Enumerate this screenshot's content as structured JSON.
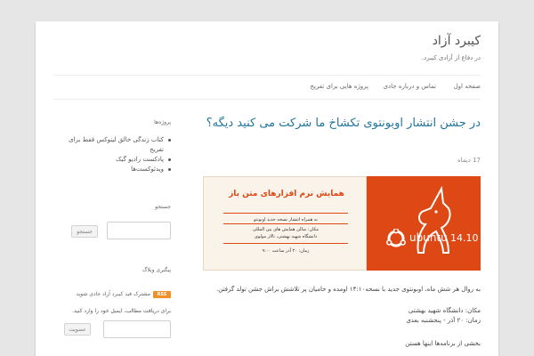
{
  "site": {
    "title": "کیبرد آزاد",
    "description": "در دفاع از آزادی کیبرد."
  },
  "nav": {
    "items": [
      {
        "label": "صفحه اول"
      },
      {
        "label": "تماس و درباره جادی"
      },
      {
        "label": "پروژه هایی برای تفریح"
      }
    ]
  },
  "post": {
    "title": "در جشن انتشار اوبونتوی تکشاخ ما شرکت می کنید دیگه؟",
    "date": "17 دیماه",
    "banner": {
      "heading": "همایش نرم افزارهای متن باز",
      "lines": [
        "به همراه انتشار نسخه جدید اوبونتو",
        "مکان: سالن همایش های بین المللی",
        "دانشگاه شهید بهشتی، تالار مولوی",
        "زمان: ۲۰ آذر ساعت ۹:۰۰"
      ],
      "brand": "ubuntu",
      "version": "14.10",
      "colors": {
        "orange": "#dd4814"
      }
    },
    "paragraphs": [
      "به روال هر شش ماه، اوبونتوی جدید با نسخه۱۴:۱۰ اومده و حامیان پر تلاشش براش جشن تولد گرفتن.",
      "مکان: دانشگاه شهید بهشتی",
      "زمان: ۲۰ آذر - پنجشنبه بعدی",
      "بخشی از برنامه‌ها اینها هستن"
    ]
  },
  "sidebar": {
    "projects": {
      "title": "پروژه‌ها",
      "items": [
        {
          "label": "کتاب زندگی خالق لینوکس قفط برای تفریح"
        },
        {
          "label": "پادکست رادیو گیک"
        },
        {
          "label": "ویدئوکست‌ها"
        }
      ]
    },
    "search": {
      "title": "جستجو",
      "button": "جستجو"
    },
    "follow": {
      "title": "پیگیری وبلاگ",
      "rss_badge": "RSS",
      "rss_text": "مشترک فید کیبرد آزاد جادی شوید"
    },
    "email": {
      "label": "برای دریافت مطالب، ایمیل خود را وارد کنید.",
      "button": "عضویت"
    }
  }
}
